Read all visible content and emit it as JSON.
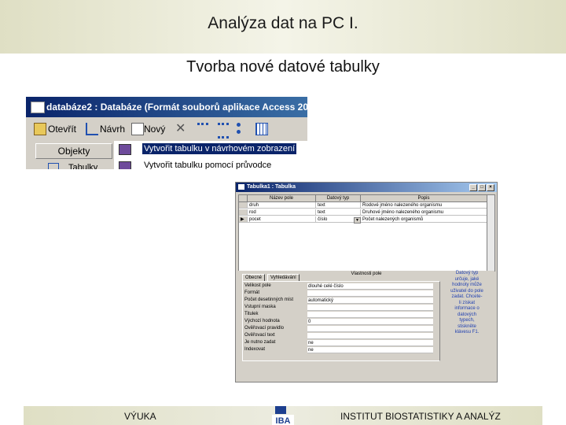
{
  "header": {
    "title": "Analýza dat na PC I."
  },
  "subtitle": "Tvorba nové datové tabulky",
  "db_window": {
    "title": "databáze2 : Databáze (Formát souborů aplikace Access 20",
    "toolbar": {
      "open": "Otevřít",
      "design": "Návrh",
      "new": "Nový"
    },
    "objects_label": "Objekty",
    "tables_label": "Tabulky",
    "items": [
      "Vytvořit tabulku v návrhovém zobrazení",
      "Vytvořit tabulku pomocí průvodce"
    ]
  },
  "table_window": {
    "title": "Tabulka1 : Tabulka",
    "columns": [
      "Název pole",
      "Datový typ",
      "Popis"
    ],
    "rows": [
      {
        "name": "druh",
        "type": "text",
        "desc": "Rodové jméno nalezeného organismu"
      },
      {
        "name": "rod",
        "type": "text",
        "desc": "Druhové jméno nalezeného organismu"
      },
      {
        "name": "pocet",
        "type": "číslo",
        "desc": "Počet nalezených organismů"
      }
    ],
    "field_props_label": "Vlastnosti pole",
    "tabs": [
      "Obecné",
      "Vyhledávání"
    ],
    "properties": [
      {
        "label": "Velikost pole",
        "value": "dlouhé celé číslo"
      },
      {
        "label": "Formát",
        "value": ""
      },
      {
        "label": "Počet desetinných míst",
        "value": "automatický"
      },
      {
        "label": "Vstupní maska",
        "value": ""
      },
      {
        "label": "Titulek",
        "value": ""
      },
      {
        "label": "Výchozí hodnota",
        "value": "0"
      },
      {
        "label": "Ověřovací pravidlo",
        "value": ""
      },
      {
        "label": "Ověřovací text",
        "value": ""
      },
      {
        "label": "Je nutno zadat",
        "value": "ne"
      },
      {
        "label": "Indexovat",
        "value": "ne"
      }
    ],
    "help_lines": [
      "Datový typ",
      "určuje, jaké",
      "hodnoty může",
      "uživatel do pole",
      "zadat. Chcete-",
      "li získat",
      "informace o",
      "datových",
      "typech,",
      "stiskněte",
      "klávesu F1."
    ]
  },
  "footer": {
    "left": "VÝUKA",
    "right": "INSTITUT BIOSTATISTIKY A ANALÝZ",
    "logo_text": "IBA"
  }
}
